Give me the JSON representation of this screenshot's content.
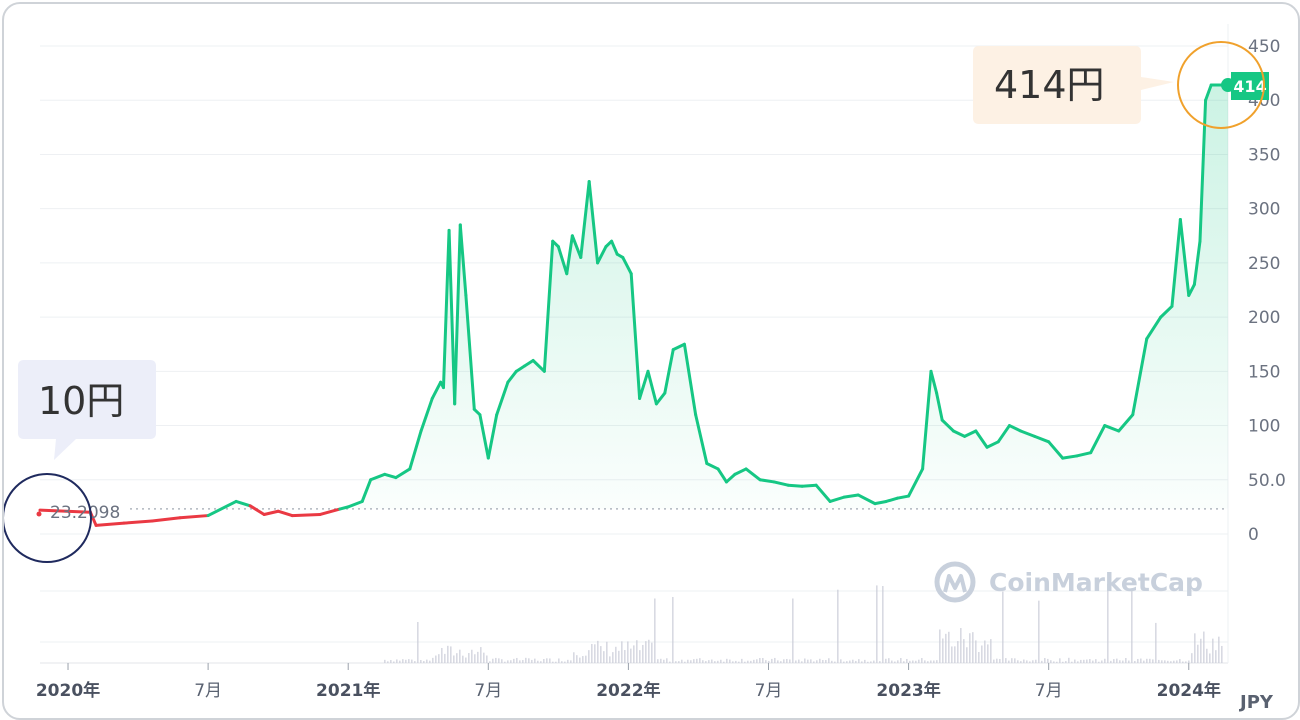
{
  "watermark": "CoinMarketCap",
  "currency_label": "JPY",
  "annotations": {
    "start_callout": "10円",
    "end_callout": "414円",
    "start_price_label": "23.2098",
    "current_price_tag": "414"
  },
  "colors": {
    "up_line": "#16c784",
    "down_line": "#ea3943",
    "price_tag_bg": "#16c784",
    "callout_peach": "#fdf1e4",
    "callout_lavender": "#eceef9",
    "circle_orange": "#f0a12c",
    "circle_navy": "#1f2a5e"
  },
  "chart_data": {
    "type": "area",
    "title": "",
    "xlabel": "",
    "ylabel": "",
    "ylim": [
      0,
      450
    ],
    "y_ticks": [
      "0",
      "50.0",
      "100",
      "150",
      "200",
      "250",
      "300",
      "350",
      "400",
      "450"
    ],
    "x_ticks": [
      {
        "label": "2020年",
        "year": true,
        "t": 2020.0
      },
      {
        "label": "7月",
        "year": false,
        "t": 2020.5
      },
      {
        "label": "2021年",
        "year": true,
        "t": 2021.0
      },
      {
        "label": "7月",
        "year": false,
        "t": 2021.5
      },
      {
        "label": "2022年",
        "year": true,
        "t": 2022.0
      },
      {
        "label": "7月",
        "year": false,
        "t": 2022.5
      },
      {
        "label": "2023年",
        "year": true,
        "t": 2023.0
      },
      {
        "label": "7月",
        "year": false,
        "t": 2023.5
      },
      {
        "label": "2024年",
        "year": true,
        "t": 2024.0
      }
    ],
    "baseline": 23.2098,
    "current_price": 414,
    "series": [
      {
        "x": [
          2019.9,
          2020.08,
          2020.1,
          2020.2,
          2020.3,
          2020.4,
          2020.5,
          2020.6,
          2020.65,
          2020.7,
          2020.75,
          2020.8,
          2020.9,
          2020.97,
          2021.0,
          2021.05,
          2021.08,
          2021.13,
          2021.17,
          2021.22,
          2021.26,
          2021.3,
          2021.33,
          2021.34,
          2021.36,
          2021.38,
          2021.4,
          2021.42,
          2021.45,
          2021.47,
          2021.5,
          2021.53,
          2021.57,
          2021.6,
          2021.63,
          2021.66,
          2021.7,
          2021.73,
          2021.75,
          2021.78,
          2021.8,
          2021.83,
          2021.86,
          2021.89,
          2021.92,
          2021.94,
          2021.96,
          2021.98,
          2022.01,
          2022.04,
          2022.07,
          2022.1,
          2022.13,
          2022.16,
          2022.2,
          2022.24,
          2022.28,
          2022.32,
          2022.35,
          2022.38,
          2022.42,
          2022.47,
          2022.52,
          2022.57,
          2022.62,
          2022.67,
          2022.72,
          2022.77,
          2022.82,
          2022.88,
          2022.92,
          2022.96,
          2023.0,
          2023.05,
          2023.08,
          2023.1,
          2023.12,
          2023.16,
          2023.2,
          2023.24,
          2023.28,
          2023.32,
          2023.36,
          2023.4,
          2023.45,
          2023.5,
          2023.55,
          2023.6,
          2023.65,
          2023.7,
          2023.75,
          2023.8,
          2023.85,
          2023.9,
          2023.94,
          2023.97,
          2024.0,
          2024.02,
          2024.04,
          2024.06,
          2024.08,
          2024.1,
          2024.11,
          2024.12,
          2024.14
        ],
        "values": [
          22,
          20,
          8,
          10,
          12,
          15,
          17,
          30,
          26,
          18,
          21,
          17,
          18,
          23,
          25,
          30,
          50,
          55,
          52,
          60,
          95,
          125,
          140,
          135,
          280,
          120,
          285,
          220,
          115,
          110,
          70,
          110,
          140,
          150,
          155,
          160,
          150,
          270,
          265,
          240,
          275,
          255,
          325,
          250,
          265,
          270,
          258,
          255,
          240,
          125,
          150,
          120,
          130,
          170,
          175,
          110,
          65,
          60,
          48,
          55,
          60,
          50,
          48,
          45,
          44,
          45,
          30,
          34,
          36,
          28,
          30,
          33,
          35,
          60,
          150,
          130,
          105,
          95,
          90,
          95,
          80,
          85,
          100,
          95,
          90,
          85,
          70,
          72,
          75,
          100,
          95,
          110,
          180,
          200,
          210,
          290,
          220,
          230,
          270,
          400,
          414,
          414,
          414,
          414,
          414
        ]
      }
    ]
  }
}
